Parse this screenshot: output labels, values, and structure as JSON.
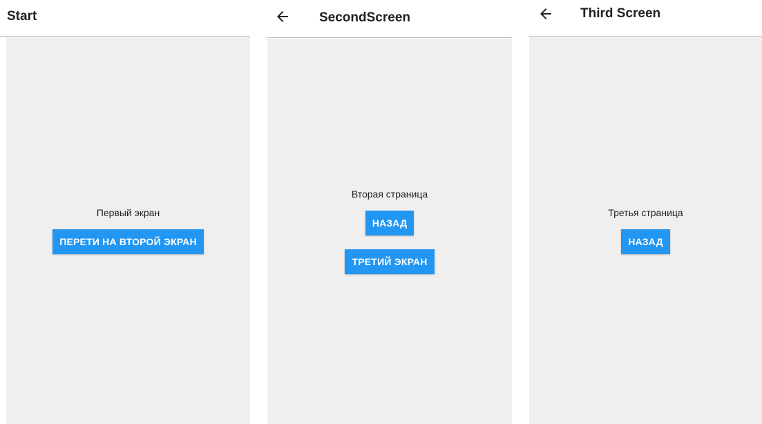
{
  "colors": {
    "accent": "#2196f3",
    "background": "#efefef",
    "appbar": "#ffffff",
    "divider": "#bdbdbd"
  },
  "screens": [
    {
      "title": "Start",
      "has_back_icon": false,
      "body_text": "Первый экран",
      "buttons": [
        {
          "label": "ПЕРЕТИ НА ВТОРОЙ ЭКРАН"
        }
      ]
    },
    {
      "title": "SecondScreen",
      "has_back_icon": true,
      "back_icon": "arrow-left-icon",
      "body_text": "Вторая страница",
      "buttons": [
        {
          "label": "НАЗАД"
        },
        {
          "label": "ТРЕТИЙ ЭКРАН"
        }
      ]
    },
    {
      "title": "Third Screen",
      "has_back_icon": true,
      "back_icon": "arrow-left-icon",
      "body_text": "Третья страница",
      "buttons": [
        {
          "label": "НАЗАД"
        }
      ]
    }
  ]
}
